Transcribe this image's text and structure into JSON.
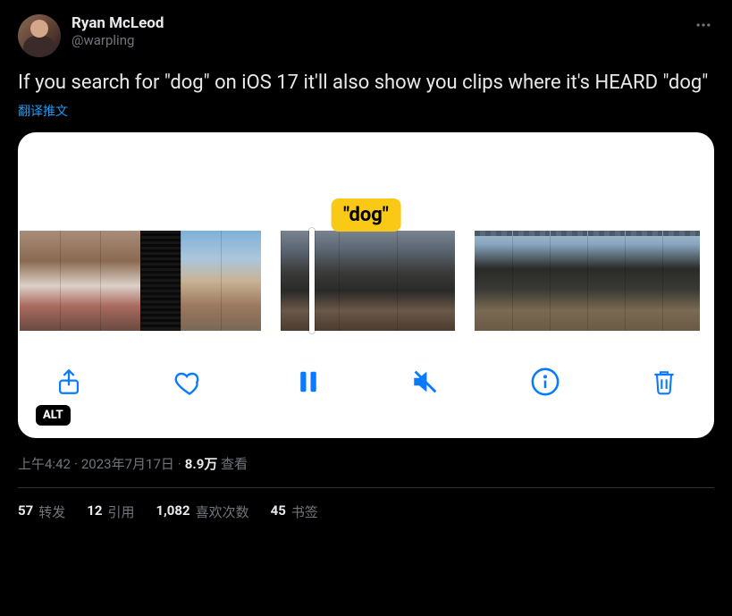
{
  "user": {
    "display_name": "Ryan McLeod",
    "handle": "@warpling"
  },
  "tweet_text": "If you search for \"dog\" on iOS 17 it'll also show you clips where it's HEARD \"dog\"",
  "translate_label": "翻译推文",
  "media": {
    "search_term_label": "\"dog\"",
    "alt_badge": "ALT"
  },
  "meta": {
    "time": "上午4:42",
    "date": "2023年7月17日",
    "views_count": "8.9万",
    "views_label": "查看"
  },
  "stats": {
    "retweets": {
      "count": "57",
      "label": "转发"
    },
    "quotes": {
      "count": "12",
      "label": "引用"
    },
    "likes": {
      "count": "1,082",
      "label": "喜欢次数"
    },
    "bookmarks": {
      "count": "45",
      "label": "书签"
    }
  }
}
